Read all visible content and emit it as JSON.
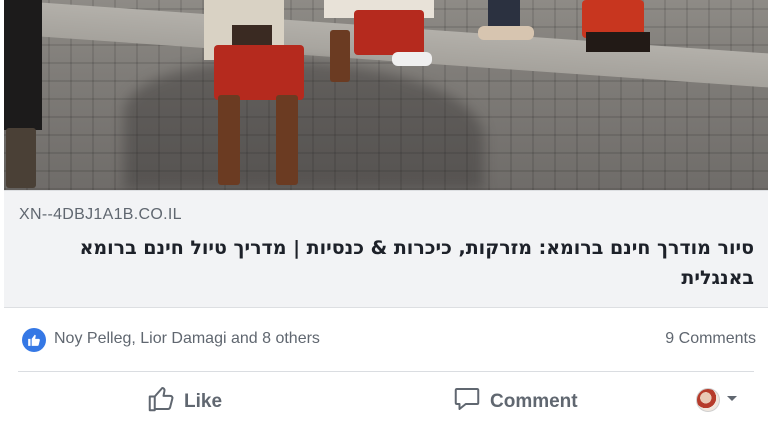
{
  "link_preview": {
    "domain": "XN--4DBJ1A1B.CO.IL",
    "title": "סיור מודרך חינם ברומא: מזרקות, כיכרות & כנסיות | מדריך טיול חינם ברומא באנגלית"
  },
  "reactions": {
    "names": "Noy Pelleg, Lior Damagi and 8 others",
    "comments": "9 Comments"
  },
  "actions": {
    "like": "Like",
    "comment": "Comment"
  },
  "colors": {
    "like_blue": "#3578e5",
    "secondary_text": "#606770",
    "preview_bg": "#f2f3f5"
  },
  "icons": [
    "like-reaction-icon",
    "thumbs-up-icon",
    "comment-icon",
    "chevron-down-icon"
  ]
}
